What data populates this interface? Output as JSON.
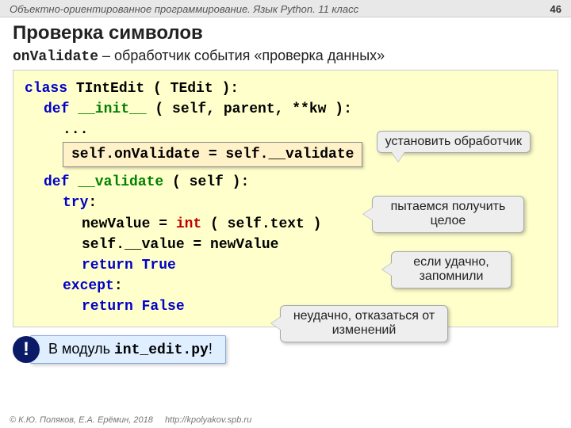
{
  "header": {
    "breadcrumb": "Объектно-ориентированное программирование. Язык Python. 11 класс",
    "page": "46"
  },
  "title": "Проверка символов",
  "subtitle": {
    "code": "onValidate",
    "rest": " – обработчик события «проверка данных»"
  },
  "code": {
    "l1_kw": "class",
    "l1_rest": " TIntEdit ( TEdit ):",
    "l2_kw": "def",
    "l2_name": " __init__",
    "l2_args": " ( self, parent, **kw ):",
    "l3": "...",
    "assign_box": "self.onValidate = self.__validate",
    "l5_kw": "def",
    "l5_name": " __validate",
    "l5_args": " ( self ):",
    "l6_kw": "try",
    "l6_colon": ":",
    "l7a": "newValue = ",
    "l7_int": "int",
    "l7b": " ( self.text )",
    "l8": "self.__value = newValue",
    "l9_kw": "return",
    "l9_val": " True",
    "l10_kw": "except",
    "l10_colon": ":",
    "l11_kw": "return",
    "l11_val": " False"
  },
  "callouts": {
    "c1": "установить обработчик",
    "c2": "пытаемся получить целое",
    "c3": "если удачно, запомнили",
    "c4": "неудачно, отказаться от изменений"
  },
  "note": {
    "icon": "!",
    "text_pre": "В модуль ",
    "text_mono": "int_edit.py",
    "text_post": "!"
  },
  "footer": {
    "copyright": "© К.Ю. Поляков, Е.А. Ерёмин, 2018",
    "url": "http://kpolyakov.spb.ru"
  }
}
